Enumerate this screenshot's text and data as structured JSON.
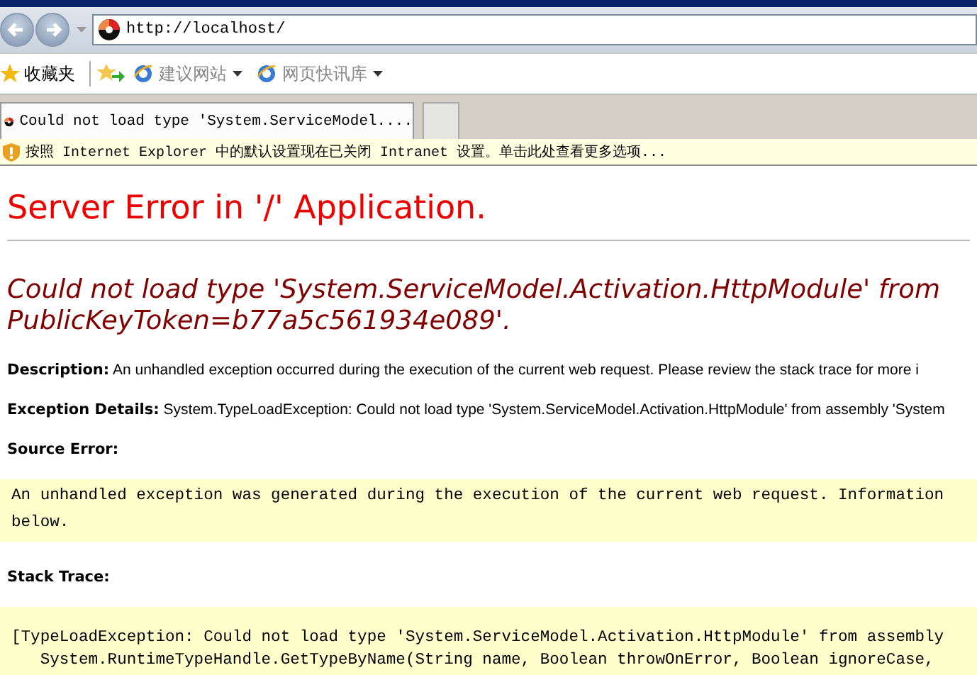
{
  "browser": {
    "address": "http://localhost/",
    "favorites": {
      "label": "收藏夹",
      "links": [
        {
          "label": "建议网站"
        },
        {
          "label": "网页快讯库"
        }
      ]
    },
    "tabs": [
      {
        "label": "Could not load type 'System.ServiceModel....",
        "selected": true
      }
    ],
    "info_bar": "按照 Internet Explorer 中的默认设置现在已关闭 Intranet 设置。单击此处查看更多选项..."
  },
  "page": {
    "title": "Server Error in '/' Application.",
    "error_lines": [
      "Could not load type 'System.ServiceModel.Activation.HttpModule' from",
      "PublicKeyToken=b77a5c561934e089'."
    ],
    "sections": [
      {
        "kind": "text",
        "label": "Description:",
        "text": "An unhandled exception occurred during the execution of the current web request. Please review the stack trace for more i"
      },
      {
        "kind": "text",
        "label": "Exception Details:",
        "text": "System.TypeLoadException: Could not load type 'System.ServiceModel.Activation.HttpModule' from assembly 'System"
      },
      {
        "kind": "code",
        "label": "Source Error:",
        "lines": [
          "An unhandled exception was generated during the execution of the current web request. Information",
          "below."
        ]
      },
      {
        "kind": "code",
        "label": "Stack Trace:",
        "lines": [
          "[TypeLoadException: Could not load type 'System.ServiceModel.Activation.HttpModule' from assembly",
          "   System.RuntimeTypeHandle.GetTypeByName(String name, Boolean throwOnError, Boolean ignoreCase,"
        ]
      }
    ]
  }
}
